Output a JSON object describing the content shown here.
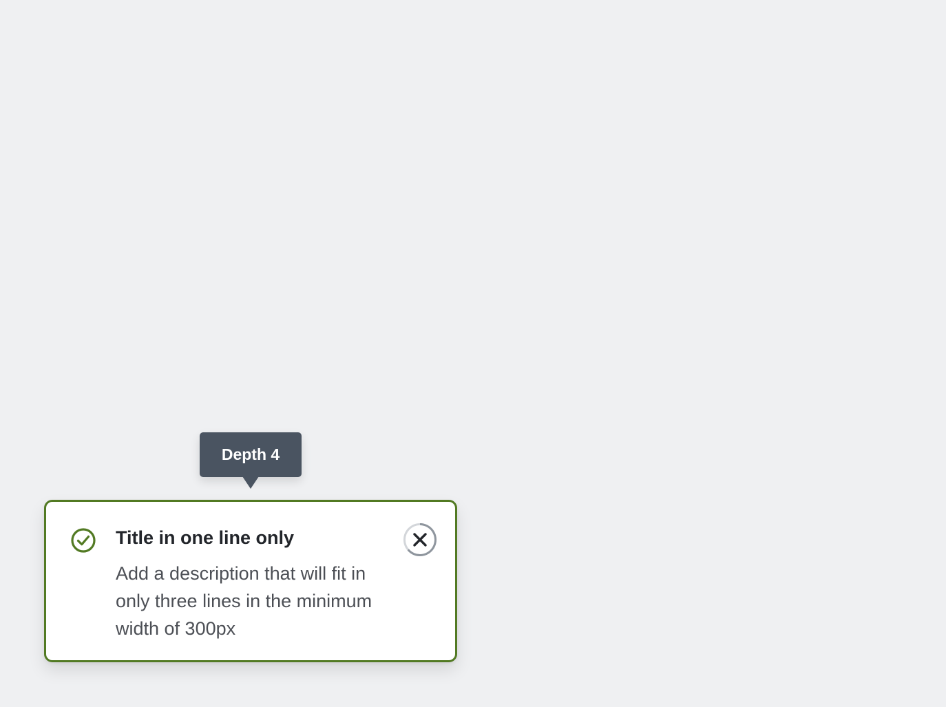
{
  "tooltip": {
    "label": "Depth 4"
  },
  "toast": {
    "status_icon": "check-circle-icon",
    "title": "Title in one line only",
    "description": "Add a description that will fit in only three lines in the minimum width of 300px",
    "close_icon": "close-icon",
    "accent_color": "#527a23"
  },
  "colors": {
    "background": "#eff0f2",
    "tooltip_background": "#4a5461",
    "success": "#527a23"
  }
}
